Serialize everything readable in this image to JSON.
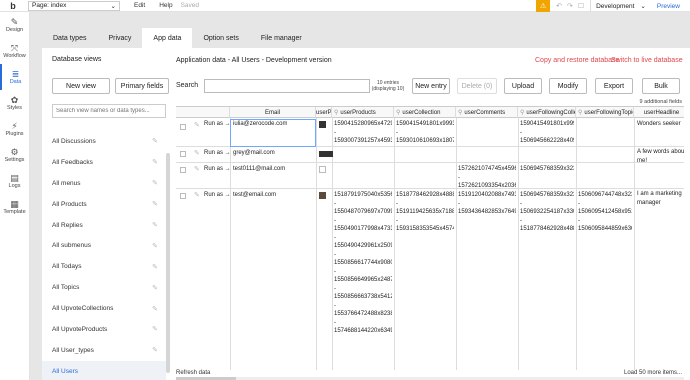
{
  "topbar": {
    "logo": "b",
    "page_select": "Page: index",
    "menu": [
      "Edit",
      "Help"
    ],
    "saved": "Saved",
    "environment": "Development",
    "preview": "Preview"
  },
  "leftnav": [
    {
      "label": "Design",
      "icon": "design-icon",
      "glyph": "✎"
    },
    {
      "label": "Workflow",
      "icon": "workflow-icon",
      "glyph": "⤧"
    },
    {
      "label": "Data",
      "icon": "database-icon",
      "glyph": "≣"
    },
    {
      "label": "Styles",
      "icon": "styles-icon",
      "glyph": "✿"
    },
    {
      "label": "Plugins",
      "icon": "plugins-icon",
      "glyph": "⚡"
    },
    {
      "label": "Settings",
      "icon": "settings-icon",
      "glyph": "⚙"
    },
    {
      "label": "Logs",
      "icon": "logs-icon",
      "glyph": "▤"
    },
    {
      "label": "Template",
      "icon": "template-icon",
      "glyph": "▦"
    }
  ],
  "tabs": [
    "Data types",
    "Privacy",
    "App data",
    "Option sets",
    "File manager"
  ],
  "views": {
    "title": "Database views",
    "new_view": "New view",
    "primary_fields": "Primary fields",
    "search_placeholder": "Search view names or data types...",
    "items": [
      "All Discussions",
      "All Feedbacks",
      "All menus",
      "All Products",
      "All Replies",
      "All submenus",
      "All Todays",
      "All Topics",
      "All UpvoteCollections",
      "All UpvoteProducts",
      "All User_types",
      "All Users"
    ]
  },
  "app": {
    "title": "Application data - All Users - Development version",
    "copy_link": "Copy and restore database",
    "switch_link": "Switch to live database",
    "search_label": "Search",
    "entries_line1": "10 entries",
    "entries_line2": "(displaying 10)",
    "buttons": {
      "new_entry": "New entry",
      "delete": "Delete (0)",
      "upload": "Upload",
      "modify": "Modify",
      "export": "Export",
      "bulk": "Bulk"
    },
    "additional_fields": "9 additional fields",
    "refresh": "Refresh data",
    "load_more": "Load 50 more items..."
  },
  "table": {
    "headers": [
      "Email",
      "userPr",
      "userProducts",
      "userCollection",
      "userComments",
      "userFollowingCollecti",
      "userFollowingTopics",
      "userHeadline"
    ],
    "run_as": "Run as →",
    "rows": [
      {
        "email": "iulia@zerocode.com",
        "products": [
          "1590415280965x4729",
          "-",
          "1593007391257x4593"
        ],
        "collection": [
          "1590415491801x9993",
          "-",
          "1593010610693x1807"
        ],
        "comments": [],
        "following_collections": [
          "1590415491801x9993",
          "-",
          "1506945662228x4090"
        ],
        "following_topics": [],
        "headline": [
          "Wonders seeker"
        ]
      },
      {
        "email": "grey@mail.com",
        "products": [],
        "collection": [],
        "comments": [],
        "following_collections": [],
        "following_topics": [],
        "headline": [
          "A few words about",
          "me!"
        ]
      },
      {
        "email": "test0111@mail.com",
        "products": [],
        "collection": [],
        "comments": [
          "1572621074745x4596",
          "-",
          "1572621093354x2036"
        ],
        "following_collections": [
          "1506945768359x3237"
        ],
        "following_topics": [],
        "headline": []
      },
      {
        "email": "test@email.com",
        "products": [
          "1518791975040x5356",
          "-",
          "1550487079697x7099",
          "-",
          "1550490177998x4733",
          "-",
          "1550490429961x2509",
          "-",
          "1550856617744x9080",
          "-",
          "1550856649965x2487",
          "-",
          "1550856663738x5412",
          "-",
          "1553766472488x8238",
          "-",
          "1574688144220x6349"
        ],
        "collection": [
          "1518778462928x4888",
          "-",
          "1519119425635x7188",
          "-",
          "1593158353545x4574"
        ],
        "comments": [
          "1519120402088x7493",
          "-",
          "1593436482853x7649"
        ],
        "following_collections": [
          "1506945768359x3237",
          "-",
          "1506932254187x3300",
          "-",
          "1518778462928x4888"
        ],
        "following_topics": [
          "1506096744748x3234",
          "-",
          "1506095412458x9513",
          "-",
          "1506095844859x6366"
        ],
        "headline": [
          "I am a marketing",
          "manager"
        ]
      }
    ]
  }
}
